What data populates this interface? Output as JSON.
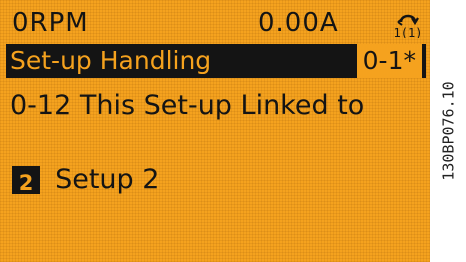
{
  "status": {
    "speed": "0RPM",
    "current": "0.00A",
    "lang_icon": "setup-indicator-icon"
  },
  "header": {
    "group": "Set-up Handling",
    "index": "0-1*"
  },
  "parameter": {
    "title": "0-12 This Set-up Linked to"
  },
  "value": {
    "setup_number": "2",
    "setup_label": "Setup 2"
  },
  "doc_ref": "130BP076.10",
  "colors": {
    "lcd_background": "#f5a21e",
    "lcd_text": "#141414"
  }
}
